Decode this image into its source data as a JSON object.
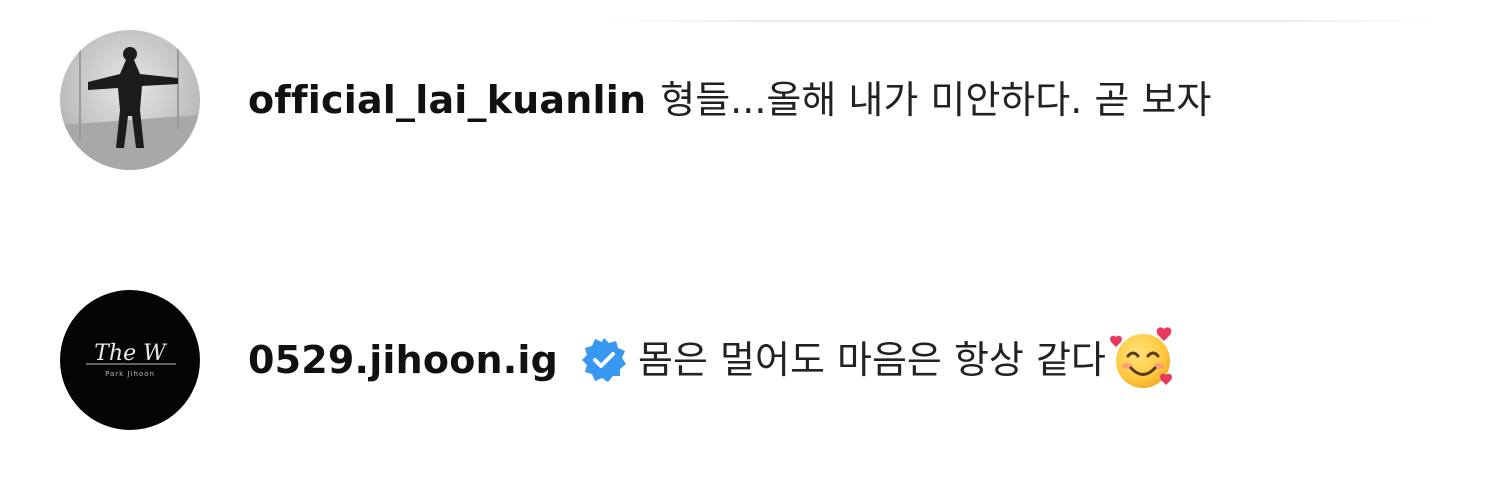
{
  "comments": [
    {
      "username": "official_lai_kuanlin",
      "message": "형들...올해 내가 미안하다. 곧 보자",
      "verified": false,
      "avatar": "grayscale-photo-person-arms-outstretched"
    },
    {
      "username": "0529.jihoon.ig",
      "message": "몸은 멀어도 마음은 항상 같다",
      "verified": true,
      "avatar": "black-logo-the-w",
      "avatar_logo_text": "The W",
      "avatar_logo_subtext": "Park Jihoon",
      "trailing_emoji": "smiling-face-with-hearts-emoji"
    }
  ],
  "colors": {
    "verified_badge": "#3897f0",
    "text": "#111111",
    "background": "#ffffff"
  }
}
